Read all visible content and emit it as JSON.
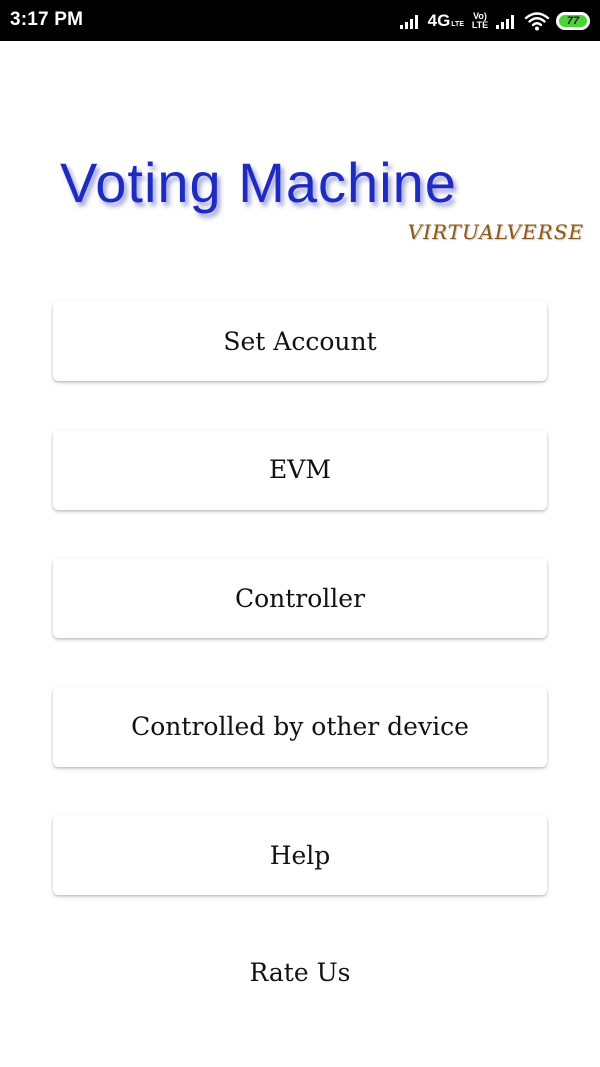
{
  "status_bar": {
    "time": "3:17 PM",
    "network_type": "4G",
    "network_sub": "LTE",
    "volte_top": "Vo)",
    "volte_bottom": "LTE",
    "battery_level": "77",
    "icons": [
      "signal-icon",
      "volte-icon",
      "signal-icon",
      "wifi-icon",
      "battery-icon"
    ],
    "battery_color": "#4cd137"
  },
  "logo": {
    "title": "Voting Machine",
    "subtitle": "VIRTUALVERSE",
    "title_color": "#1f2bbf",
    "subtitle_color": "#8a5a1c"
  },
  "menu": {
    "buttons": [
      {
        "label": "Set Account"
      },
      {
        "label": "EVM"
      },
      {
        "label": "Controller"
      },
      {
        "label": "Controlled by other device"
      },
      {
        "label": "Help"
      }
    ],
    "rate_us": "Rate Us"
  }
}
